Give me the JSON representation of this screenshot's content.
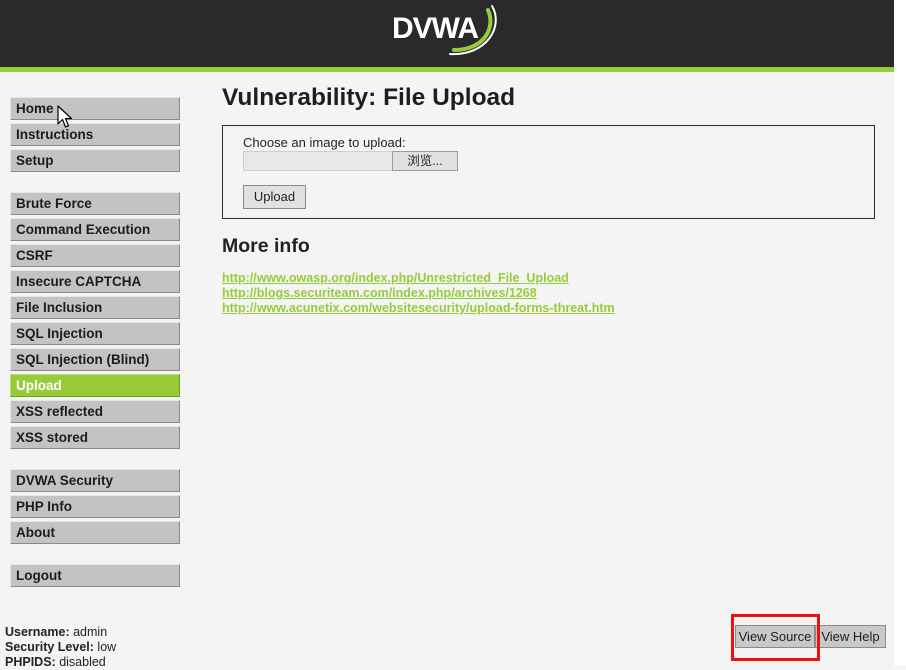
{
  "header": {
    "logo_text": "DVWA",
    "colors": {
      "bar": "#2a2a2a",
      "accent": "#96cc3b"
    }
  },
  "sidebar": {
    "items": [
      {
        "label": "Home",
        "selected": false
      },
      {
        "label": "Instructions",
        "selected": false
      },
      {
        "label": "Setup",
        "selected": false
      },
      {
        "label": "Brute Force",
        "selected": false
      },
      {
        "label": "Command Execution",
        "selected": false
      },
      {
        "label": "CSRF",
        "selected": false
      },
      {
        "label": "Insecure CAPTCHA",
        "selected": false
      },
      {
        "label": "File Inclusion",
        "selected": false
      },
      {
        "label": "SQL Injection",
        "selected": false
      },
      {
        "label": "SQL Injection (Blind)",
        "selected": false
      },
      {
        "label": "Upload",
        "selected": true
      },
      {
        "label": "XSS reflected",
        "selected": false
      },
      {
        "label": "XSS stored",
        "selected": false
      },
      {
        "label": "DVWA Security",
        "selected": false
      },
      {
        "label": "PHP Info",
        "selected": false
      },
      {
        "label": "About",
        "selected": false
      },
      {
        "label": "Logout",
        "selected": false
      }
    ],
    "selected_color": "#97cb3a"
  },
  "main": {
    "title": "Vulnerability: File Upload",
    "upload_form": {
      "label": "Choose an image to upload:",
      "file_value": "",
      "browse_label": "浏览...",
      "upload_label": "Upload"
    },
    "more_info_title": "More info",
    "links": [
      "http://www.owasp.org/index.php/Unrestricted_File_Upload",
      "http://blogs.securiteam.com/index.php/archives/1268",
      "http://www.acunetix.com/websitesecurity/upload-forms-threat.htm"
    ],
    "link_color": "#97cb3a"
  },
  "footer": {
    "view_source_label": "View Source",
    "view_help_label": "View Help",
    "highlight_color": "#ee1111"
  },
  "status": {
    "username_label": "Username:",
    "username_value": "admin",
    "security_label": "Security Level:",
    "security_value": "low",
    "phpids_label": "PHPIDS:",
    "phpids_value": "disabled"
  }
}
